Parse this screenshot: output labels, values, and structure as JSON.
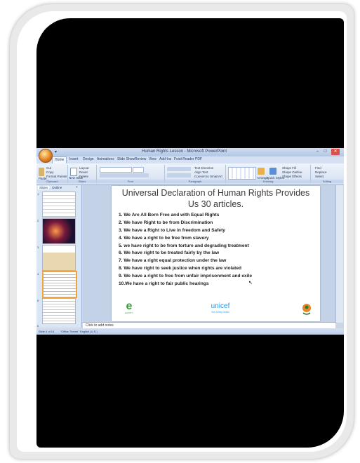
{
  "window": {
    "title": "Human Rights Lesson - Microsoft PowerPoint",
    "quick_access": "▾",
    "minimize": "–",
    "maximize": "□",
    "close": "✕"
  },
  "ribbon_tabs": [
    "Home",
    "Insert",
    "Design",
    "Animations",
    "Slide Show",
    "Review",
    "View",
    "Add-Ins",
    "Foxit Reader PDF"
  ],
  "ribbon_groups": {
    "clipboard": {
      "label": "Clipboard",
      "items": [
        "Cut",
        "Copy",
        "Paste",
        "Format Painter"
      ]
    },
    "slides": {
      "label": "Slides",
      "items": [
        "New Slide",
        "Layout",
        "Reset",
        "Delete"
      ]
    },
    "font": {
      "label": "Font"
    },
    "paragraph": {
      "label": "Paragraph",
      "items": [
        "Text Direction",
        "Align Text",
        "Convert to SmartArt"
      ]
    },
    "drawing": {
      "label": "Drawing",
      "items": [
        "Arrange",
        "Quick Styles",
        "Shape Fill",
        "Shape Outline",
        "Shape Effects"
      ]
    },
    "editing": {
      "label": "Editing",
      "items": [
        "Find",
        "Replace",
        "Select"
      ]
    }
  },
  "left_pane": {
    "tabs": [
      "Slides",
      "Outline"
    ],
    "slide_numbers": [
      "1",
      "2",
      "3",
      "4",
      "5",
      "6"
    ]
  },
  "slide": {
    "title": "Universal Declaration of Human Rights Provides Us 30 articles.",
    "articles": [
      "1. We Are All Born Free and with Equal Rights",
      "2. We have Right to be from Discrimination",
      "3. We have a Right to Live in freedom and Safety",
      "4. We have a right to be free from slavery",
      "5. we have right to be from torture and degrading treatment",
      "6. We have right to be treated fairly by the law",
      "7. We have a right equal protection under the law",
      "8. We have right to seek justice when rights are violated",
      "9. We have a right to free from unfair imprisonment and exile",
      "10.We have a right to fair public hearings"
    ],
    "logos": {
      "left_mark": "e",
      "left_caption": "EQUITY",
      "center_name": "unicef",
      "center_sub": "for every child"
    }
  },
  "notes_placeholder": "Click to add notes",
  "status": {
    "slide": "Slide 4 of 14",
    "theme": "\"Office Theme\"",
    "language": "English (U.S.)"
  },
  "colors": {
    "ribbon_bg": "#d4e0f1",
    "unicef_blue": "#1a9be6",
    "close_red": "#d9534a"
  }
}
